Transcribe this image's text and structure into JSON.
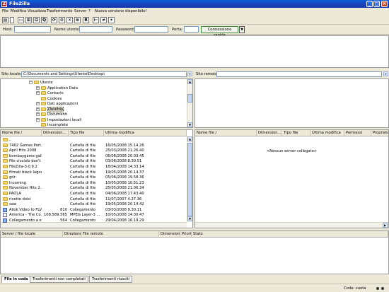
{
  "window": {
    "title": "FileZilla",
    "minimize": "_",
    "maximize": "□",
    "close": "×"
  },
  "menu": [
    "File",
    "Modifica",
    "Visualizza",
    "Trasferimento",
    "Server",
    "?",
    "Nuova versione disponibile!"
  ],
  "toolbar": {
    "icons": [
      "site-manager-icon",
      "message-log-icon",
      "local-tree-icon",
      "remote-tree-icon",
      "queue-icon",
      "refresh-icon",
      "process-queue-icon",
      "cancel-icon",
      "disconnect-icon",
      "reconnect-icon",
      "filter-icon",
      "compare-icon",
      "binoculars-icon"
    ],
    "glyphs": [
      "▤",
      "▭",
      "⊞",
      "⊟",
      "Q",
      "⟳",
      "⚙",
      "✕",
      "⊗",
      "R",
      "⊢",
      "≠",
      "⚭"
    ]
  },
  "quickconnect": {
    "host_label": "Host:",
    "user_label": "Nome utente:",
    "pass_label": "Password:",
    "port_label": "Porta:",
    "host_value": "",
    "user_value": "",
    "pass_value": "",
    "port_value": "",
    "button": "Connessione rapida",
    "dropdown": "▼"
  },
  "local": {
    "path_label": "Sito locale:",
    "path_value": "C:\\Documents and Settings\\Utente\\Desktop\\",
    "tree": [
      {
        "label": "Utente",
        "expander": "−",
        "level": 0
      },
      {
        "label": "Application Data",
        "expander": "+",
        "level": 1
      },
      {
        "label": "Contacts",
        "expander": "+",
        "level": 1
      },
      {
        "label": "Cookies",
        "expander": "",
        "level": 1
      },
      {
        "label": "Dati applicazioni",
        "expander": "+",
        "level": 1
      },
      {
        "label": "Desktop",
        "expander": "+",
        "level": 1,
        "selected": true
      },
      {
        "label": "Documenti",
        "expander": "+",
        "level": 1
      },
      {
        "label": "Impostazioni locali",
        "expander": "+",
        "level": 1
      },
      {
        "label": "Incomplete",
        "expander": "",
        "level": 1
      }
    ],
    "columns": [
      "Nome file  /",
      "Dimension...",
      "Tipo file",
      "Ultima modifica"
    ],
    "files": [
      {
        "name": "..",
        "size": "",
        "type": "",
        "modified": "",
        "icon": "folder"
      },
      {
        "name": "7402 Games Port...",
        "size": "",
        "type": "Cartella di file",
        "modified": "16/05/2008 15.14.26",
        "icon": "folder"
      },
      {
        "name": "April Hits 2008",
        "size": "",
        "type": "Cartella di file",
        "modified": "25/03/2008 21.26.40",
        "icon": "folder"
      },
      {
        "name": "bombaygame gall...",
        "size": "",
        "type": "Cartella di file",
        "modified": "06/06/2008 20.03.45",
        "icon": "folder"
      },
      {
        "name": "File cicciolo don't ...",
        "size": "",
        "type": "Cartella di file",
        "modified": "03/06/2008 8.30.51",
        "icon": "folder"
      },
      {
        "name": "FileZilla-3.0.9.2",
        "size": "",
        "type": "Cartella di file",
        "modified": "18/04/2008 14.33.14",
        "icon": "folder"
      },
      {
        "name": "filmati black lagoon",
        "size": "",
        "type": "Cartella di file",
        "modified": "19/05/2008 20.14.37",
        "icon": "folder"
      },
      {
        "name": "gdr",
        "size": "",
        "type": "Cartella di file",
        "modified": "05/06/2008 19.58.36",
        "icon": "folder"
      },
      {
        "name": "Incoming",
        "size": "",
        "type": "Cartella di file",
        "modified": "10/05/2008 10.51.23",
        "icon": "folder"
      },
      {
        "name": "November Hits 2...",
        "size": "",
        "type": "Cartella di file",
        "modified": "25/05/2008 21.06.34",
        "icon": "folder"
      },
      {
        "name": "PAOLA",
        "size": "",
        "type": "Cartella di file",
        "modified": "04/06/2008 17.43.40",
        "icon": "folder"
      },
      {
        "name": "ricette dolci",
        "size": "",
        "type": "Cartella di file",
        "modified": "11/07/2007 4.27.36",
        "icon": "folder"
      },
      {
        "name": "saw",
        "size": "",
        "type": "Cartella di file",
        "modified": "19/05/2008 20.14.42",
        "icon": "folder"
      },
      {
        "name": "Allok Video to FLV...",
        "size": "810",
        "type": "Collegamento",
        "modified": "03/03/2008 9.30.11",
        "icon": "link"
      },
      {
        "name": "America - The Co...",
        "size": "108.589.565",
        "type": "MPEG Layer-3 ...",
        "modified": "10/05/2008 14.30.47",
        "icon": "file"
      },
      {
        "name": "Collegamento a e...",
        "size": "564",
        "type": "Collegamento",
        "modified": "29/04/2008 16.19.29",
        "icon": "link"
      }
    ]
  },
  "remote": {
    "path_label": "Sito remoto:",
    "path_value": "",
    "columns": [
      "Nome file  /",
      "Dimension...",
      "Tipo file",
      "Ultima modifica",
      "Permessi",
      "Proprietario"
    ],
    "empty_message": "<Nessun server collegato>"
  },
  "queue": {
    "columns": [
      "Server / file locale",
      "Direzione",
      "File remoto",
      "Dimensione",
      "Priorità",
      "Stato"
    ]
  },
  "tabs": [
    "File in coda",
    "Trasferimenti non completati",
    "Trasferimenti riusciti"
  ],
  "status": {
    "queue_label": "Coda: vuota"
  },
  "colors": {
    "titlebar": "#0a5fd9",
    "chrome": "#ece9d8",
    "folder": "#f3d56a",
    "connect_border": "#3c8c3c"
  }
}
